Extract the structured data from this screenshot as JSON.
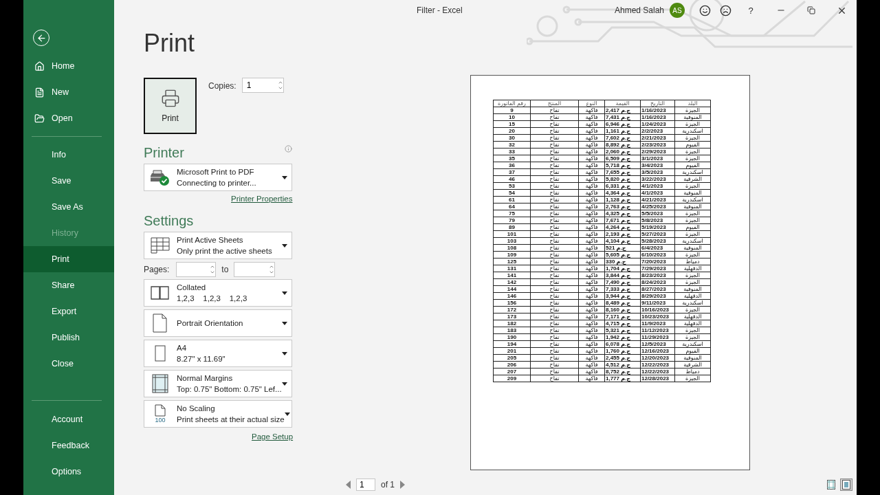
{
  "window": {
    "title": "Filter  -  Excel",
    "user": "Ahmed Salah",
    "avatar": "AS",
    "help": "?"
  },
  "sidebar": {
    "groups": [
      {
        "items": [
          {
            "label": "Home",
            "kind": "home",
            "selected": false,
            "disabled": false
          },
          {
            "label": "New",
            "kind": "new",
            "selected": false,
            "disabled": false
          },
          {
            "label": "Open",
            "kind": "open",
            "selected": false,
            "disabled": false
          }
        ]
      },
      {
        "items": [
          {
            "label": "Info",
            "kind": "plain",
            "selected": false,
            "disabled": false
          },
          {
            "label": "Save",
            "kind": "plain",
            "selected": false,
            "disabled": false
          },
          {
            "label": "Save As",
            "kind": "plain",
            "selected": false,
            "disabled": false
          },
          {
            "label": "History",
            "kind": "plain",
            "selected": false,
            "disabled": true
          },
          {
            "label": "Print",
            "kind": "plain",
            "selected": true,
            "disabled": false
          },
          {
            "label": "Share",
            "kind": "plain",
            "selected": false,
            "disabled": false
          },
          {
            "label": "Export",
            "kind": "plain",
            "selected": false,
            "disabled": false
          },
          {
            "label": "Publish",
            "kind": "plain",
            "selected": false,
            "disabled": false
          },
          {
            "label": "Close",
            "kind": "plain",
            "selected": false,
            "disabled": false
          }
        ]
      },
      {
        "items": [
          {
            "label": "Account",
            "kind": "plain",
            "selected": false,
            "disabled": false
          },
          {
            "label": "Feedback",
            "kind": "plain",
            "selected": false,
            "disabled": false
          },
          {
            "label": "Options",
            "kind": "plain",
            "selected": false,
            "disabled": false
          }
        ]
      }
    ]
  },
  "print": {
    "title": "Print",
    "button": "Print",
    "copies_label": "Copies:",
    "copies": "1"
  },
  "printer": {
    "heading": "Printer",
    "name": "Microsoft Print to PDF",
    "status": "Connecting to printer...",
    "link": "Printer Properties"
  },
  "settings": {
    "heading": "Settings",
    "scope": {
      "kind": "sheets",
      "title": "Print Active Sheets",
      "subtitle": "Only print the active sheets"
    },
    "pages_label": "Pages:",
    "to_label": "to",
    "options": [
      {
        "kind": "collated",
        "title": "Collated",
        "subtitle": "1,2,3    1,2,3    1,2,3"
      },
      {
        "kind": "orientation",
        "title": "Portrait Orientation"
      },
      {
        "kind": "paper",
        "title": "A4",
        "subtitle": "8.27\" x 11.69\""
      },
      {
        "kind": "margins",
        "title": "Normal Margins",
        "subtitle": "Top: 0.75\" Bottom: 0.75\" Lef..."
      },
      {
        "kind": "scaling",
        "title": "No Scaling",
        "subtitle": "Print sheets at their actual size",
        "icon_text": "100"
      }
    ],
    "link": "Page Setup"
  },
  "preview": {
    "table": {
      "columns": [
        "البلد",
        "التاريخ",
        "القيمة",
        "النوع",
        "المنتج",
        "رقم الفاتورة"
      ],
      "rows": [
        [
          "الجيزة",
          "1/16/2023",
          "ج.م 2,417",
          "فاكهة",
          "تفاح",
          "9"
        ],
        [
          "المنوفية",
          "1/16/2023",
          "ج.م 7,431",
          "فاكهة",
          "تفاح",
          "10"
        ],
        [
          "الجيزة",
          "1/24/2023",
          "ج.م 6,946",
          "فاكهة",
          "تفاح",
          "15"
        ],
        [
          "اسكندرية",
          "2/2/2023",
          "ج.م 1,161",
          "فاكهة",
          "تفاح",
          "20"
        ],
        [
          "الجيزة",
          "2/21/2023",
          "ج.م 7,602",
          "فاكهة",
          "تفاح",
          "30"
        ],
        [
          "الفيوم",
          "2/23/2023",
          "ج.م 8,892",
          "فاكهة",
          "تفاح",
          "32"
        ],
        [
          "الجيزة",
          "2/29/2023",
          "ج.م 2,060",
          "فاكهة",
          "تفاح",
          "33"
        ],
        [
          "الجيزة",
          "3/1/2023",
          "ج.م 6,509",
          "فاكهة",
          "تفاح",
          "35"
        ],
        [
          "الفيوم",
          "3/4/2023",
          "ج.م 5,718",
          "فاكهة",
          "تفاح",
          "36"
        ],
        [
          "اسكندرية",
          "3/5/2023",
          "ج.م 7,655",
          "فاكهة",
          "تفاح",
          "37"
        ],
        [
          "الشرقية",
          "3/22/2023",
          "ج.م 5,820",
          "فاكهة",
          "تفاح",
          "46"
        ],
        [
          "الجيزة",
          "4/1/2023",
          "ج.م 6,331",
          "فاكهة",
          "تفاح",
          "53"
        ],
        [
          "المنوفية",
          "4/1/2023",
          "ج.م 4,364",
          "فاكهة",
          "تفاح",
          "54"
        ],
        [
          "اسكندرية",
          "4/21/2023",
          "ج.م 1,128",
          "فاكهة",
          "تفاح",
          "61"
        ],
        [
          "المنوفية",
          "4/25/2023",
          "ج.م 2,763",
          "فاكهة",
          "تفاح",
          "64"
        ],
        [
          "الجيزة",
          "5/5/2023",
          "ج.م 4,325",
          "فاكهة",
          "تفاح",
          "75"
        ],
        [
          "الجيزة",
          "5/8/2023",
          "ج.م 7,671",
          "فاكهة",
          "تفاح",
          "79"
        ],
        [
          "الفيوم",
          "5/19/2023",
          "ج.م 4,264",
          "فاكهة",
          "تفاح",
          "89"
        ],
        [
          "الجيزة",
          "5/27/2023",
          "ج.م 2,193",
          "فاكهة",
          "تفاح",
          "101"
        ],
        [
          "اسكندرية",
          "5/28/2023",
          "ج.م 4,104",
          "فاكهة",
          "تفاح",
          "103"
        ],
        [
          "المنوفية",
          "6/4/2023",
          "ج.م 521",
          "فاكهة",
          "تفاح",
          "108"
        ],
        [
          "الجيزة",
          "6/10/2023",
          "ج.م 5,605",
          "فاكهة",
          "تفاح",
          "109"
        ],
        [
          "دمياط",
          "7/20/2023",
          "ج.م 330",
          "فاكهة",
          "تفاح",
          "125"
        ],
        [
          "الدقهلية",
          "7/29/2023",
          "ج.م 1,704",
          "فاكهة",
          "تفاح",
          "131"
        ],
        [
          "الجيزة",
          "8/23/2023",
          "ج.م 3,844",
          "فاكهة",
          "تفاح",
          "141"
        ],
        [
          "الجيزة",
          "8/24/2023",
          "ج.م 7,490",
          "فاكهة",
          "تفاح",
          "142"
        ],
        [
          "المنوفية",
          "8/27/2023",
          "ج.م 7,333",
          "فاكهة",
          "تفاح",
          "144"
        ],
        [
          "الدقهلية",
          "8/29/2023",
          "ج.م 3,944",
          "فاكهة",
          "تفاح",
          "146"
        ],
        [
          "اسكندرية",
          "9/11/2023",
          "ج.م 8,489",
          "فاكهة",
          "تفاح",
          "156"
        ],
        [
          "الجيزة",
          "10/16/2023",
          "ج.م 8,160",
          "فاكهة",
          "تفاح",
          "172"
        ],
        [
          "الدقهلية",
          "10/23/2023",
          "ج.م 7,171",
          "فاكهة",
          "تفاح",
          "173"
        ],
        [
          "الدقهلية",
          "11/9/2023",
          "ج.م 4,715",
          "فاكهة",
          "تفاح",
          "182"
        ],
        [
          "الجيزة",
          "11/12/2023",
          "ج.م 5,321",
          "فاكهة",
          "تفاح",
          "183"
        ],
        [
          "الجيزة",
          "11/29/2023",
          "ج.م 1,942",
          "فاكهة",
          "تفاح",
          "190"
        ],
        [
          "اسكندرية",
          "12/5/2023",
          "ج.م 6,078",
          "فاكهة",
          "تفاح",
          "194"
        ],
        [
          "الفيوم",
          "12/16/2023",
          "ج.م 1,760",
          "فاكهة",
          "تفاح",
          "201"
        ],
        [
          "المنوفية",
          "12/20/2023",
          "ج.م 2,455",
          "فاكهة",
          "تفاح",
          "205"
        ],
        [
          "الشرقية",
          "12/22/2023",
          "ج.م 4,512",
          "فاكهة",
          "تفاح",
          "206"
        ],
        [
          "دمياط",
          "12/22/2023",
          "ج.م 8,752",
          "فاكهة",
          "تفاح",
          "207"
        ],
        [
          "الجيزة",
          "12/28/2023",
          "ج.م 1,777",
          "فاكهة",
          "تفاح",
          "209"
        ]
      ]
    },
    "page": "1",
    "page_total": "of 1",
    "view_buttons": [
      {
        "kind": "margins",
        "selected": false
      },
      {
        "kind": "page",
        "selected": true
      }
    ]
  }
}
